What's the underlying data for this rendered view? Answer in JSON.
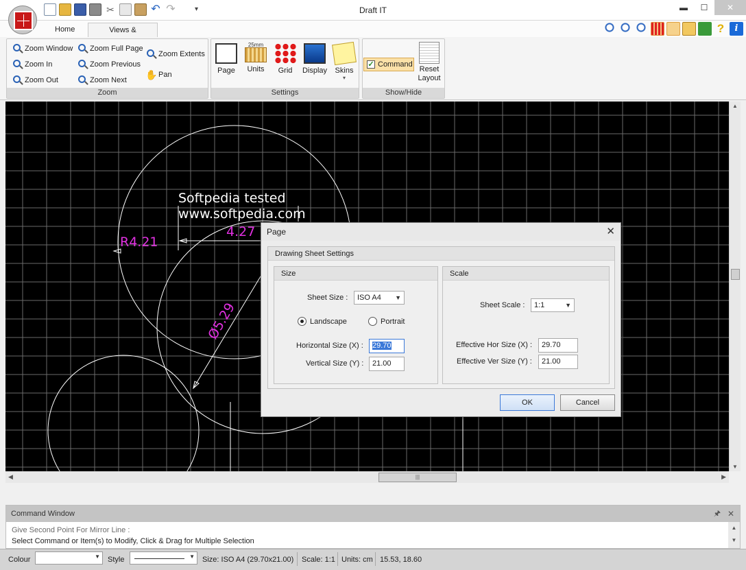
{
  "window": {
    "title": "Draft IT",
    "minimize": "▬",
    "maximize": "☐",
    "close": "✕"
  },
  "tabs": [
    "Home",
    "Views & Settings"
  ],
  "ribbon": {
    "zoom": {
      "label": "Zoom",
      "items": [
        "Zoom Window",
        "Zoom In",
        "Zoom Out",
        "Zoom Full Page",
        "Zoom Previous",
        "Zoom Next",
        "Zoom Extents",
        "Pan"
      ]
    },
    "settings": {
      "label": "Settings",
      "items": [
        "Page",
        "Units",
        "Grid",
        "Display",
        "Skins"
      ],
      "units_icon_text": "25mm"
    },
    "showhide": {
      "label": "Show/Hide",
      "command": "Command",
      "reset_line1": "Reset",
      "reset_line2": "Layout"
    }
  },
  "canvas": {
    "watermark_line1": "Softpedia  tested",
    "watermark_line2": "www.softpedia.com",
    "dim_radius": "R4.21",
    "dim_linear": "4.27",
    "dim_diameter": "Ø5.29"
  },
  "dialog": {
    "title": "Page",
    "frame_title": "Drawing Sheet Settings",
    "size": {
      "heading": "Size",
      "sheet_size_label": "Sheet Size :",
      "sheet_size_value": "ISO A4",
      "landscape": "Landscape",
      "portrait": "Portrait",
      "orientation": "Landscape",
      "horiz_label": "Horizontal Size (X) :",
      "horiz_value": "29.70",
      "vert_label": "Vertical Size (Y) :",
      "vert_value": "21.00"
    },
    "scale": {
      "heading": "Scale",
      "sheet_scale_label": "Sheet Scale :",
      "sheet_scale_value": "1:1",
      "eff_hor_label": "Effective Hor Size (X) :",
      "eff_hor_value": "29.70",
      "eff_ver_label": "Effective Ver Size (Y) :",
      "eff_ver_value": "21.00"
    },
    "ok": "OK",
    "cancel": "Cancel"
  },
  "command_window": {
    "title": "Command Window",
    "pin": "🖈",
    "close": "✕",
    "hint": "Give Second Point For Mirror Line :",
    "prompt": "Select Command or Item(s) to Modify, Click & Drag for Multiple Selection"
  },
  "status": {
    "colour_label": "Colour",
    "style_label": "Style",
    "size": "Size: ISO A4 (29.70x21.00)",
    "scale": "Scale: 1:1",
    "units": "Units: cm",
    "coords": "15.53, 18.60"
  },
  "colors": {
    "dimension": "#e030e0",
    "geometry": "#ffffff",
    "grid": "#6a6a6a",
    "canvas_bg": "#000000"
  }
}
